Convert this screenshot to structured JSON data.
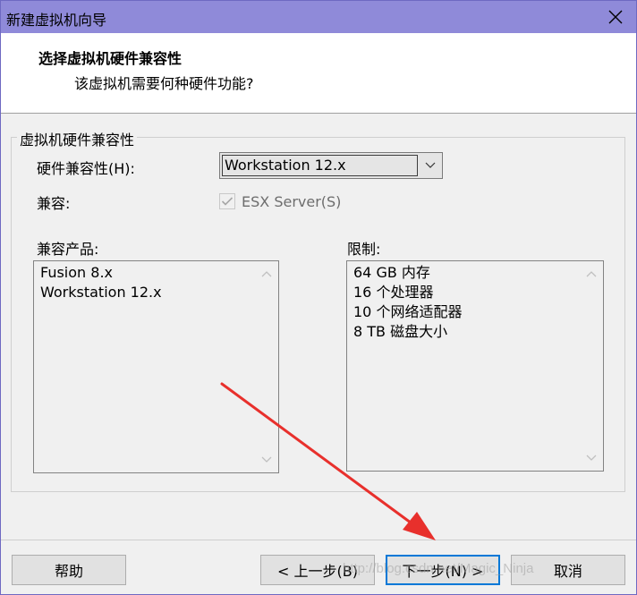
{
  "window": {
    "title": "新建虚拟机向导"
  },
  "header": {
    "title": "选择虚拟机硬件兼容性",
    "subtitle": "该虚拟机需要何种硬件功能?"
  },
  "group": {
    "legend": "虚拟机硬件兼容性",
    "hw_compat_label": "硬件兼容性(H):",
    "hw_compat_value": "Workstation 12.x",
    "compatible_label": "兼容:",
    "esx_label": "ESX Server(S)",
    "esx_checked": true,
    "esx_enabled": false,
    "products_label": "兼容产品:",
    "products": [
      "Fusion 8.x",
      "Workstation 12.x"
    ],
    "limits_label": "限制:",
    "limits": [
      "64 GB 内存",
      "16 个处理器",
      "10 个网络适配器",
      "8 TB 磁盘大小"
    ]
  },
  "buttons": {
    "help": "帮助",
    "back": "< 上一步(B)",
    "next": "下一步(N) >",
    "cancel": "取消"
  },
  "watermark": "http://blog.csdn.net/Magic_Ninja",
  "colors": {
    "titlebar": "#8f8ad9",
    "annotation_arrow": "#e8302c",
    "default_button_border": "#0078d7"
  },
  "icons": {
    "close": "close-icon",
    "dropdown": "chevron-down-icon",
    "check": "checkmark-icon",
    "scroll_up": "chevron-up-icon",
    "scroll_down": "chevron-down-icon"
  }
}
